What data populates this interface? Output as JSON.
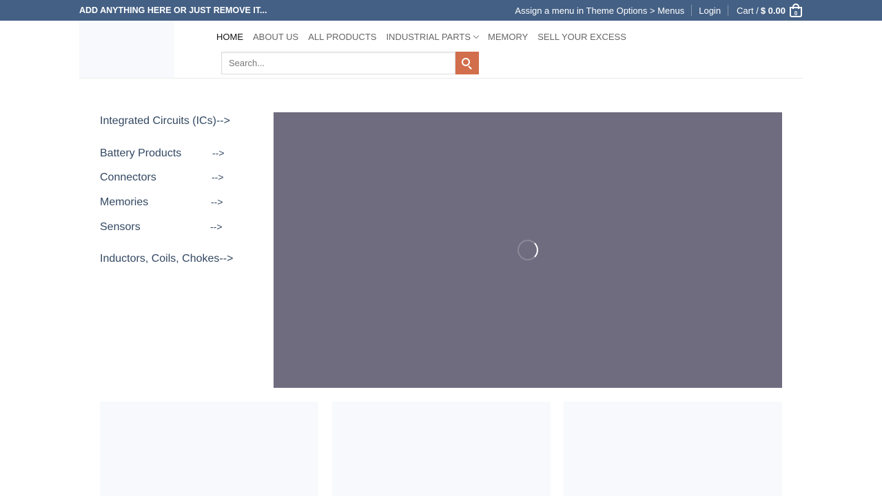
{
  "topbar": {
    "promo_text": "ADD ANYTHING HERE OR JUST REMOVE IT...",
    "menu_hint": "Assign a menu in Theme Options > Menus",
    "login": "Login",
    "cart_label": "Cart /",
    "cart_amount": "$ 0.00",
    "cart_count": "0",
    "bg_color": "#446084"
  },
  "nav": {
    "items": [
      {
        "label": "HOME"
      },
      {
        "label": "ABOUT US"
      },
      {
        "label": "ALL PRODUCTS"
      },
      {
        "label": "INDUSTRIAL PARTS"
      },
      {
        "label": "MEMORY"
      },
      {
        "label": "SELL YOUR EXCESS"
      }
    ]
  },
  "search": {
    "placeholder": "Search...",
    "icon": "search-icon",
    "button_color": "#d26e4b"
  },
  "categories": [
    {
      "label": "Integrated Circuits (ICs)-->",
      "arrow": ""
    },
    {
      "label": "Battery Products",
      "arrow": "-->"
    },
    {
      "label": "Connectors",
      "arrow": "-->"
    },
    {
      "label": "Memories",
      "arrow": "-->"
    },
    {
      "label": "Sensors",
      "arrow": "-->"
    },
    {
      "label": "Inductors, Coils, Chokes-->",
      "arrow": ""
    }
  ],
  "slider": {
    "bg_color": "#6f6c7f",
    "loading_icon": "spinner-icon"
  }
}
